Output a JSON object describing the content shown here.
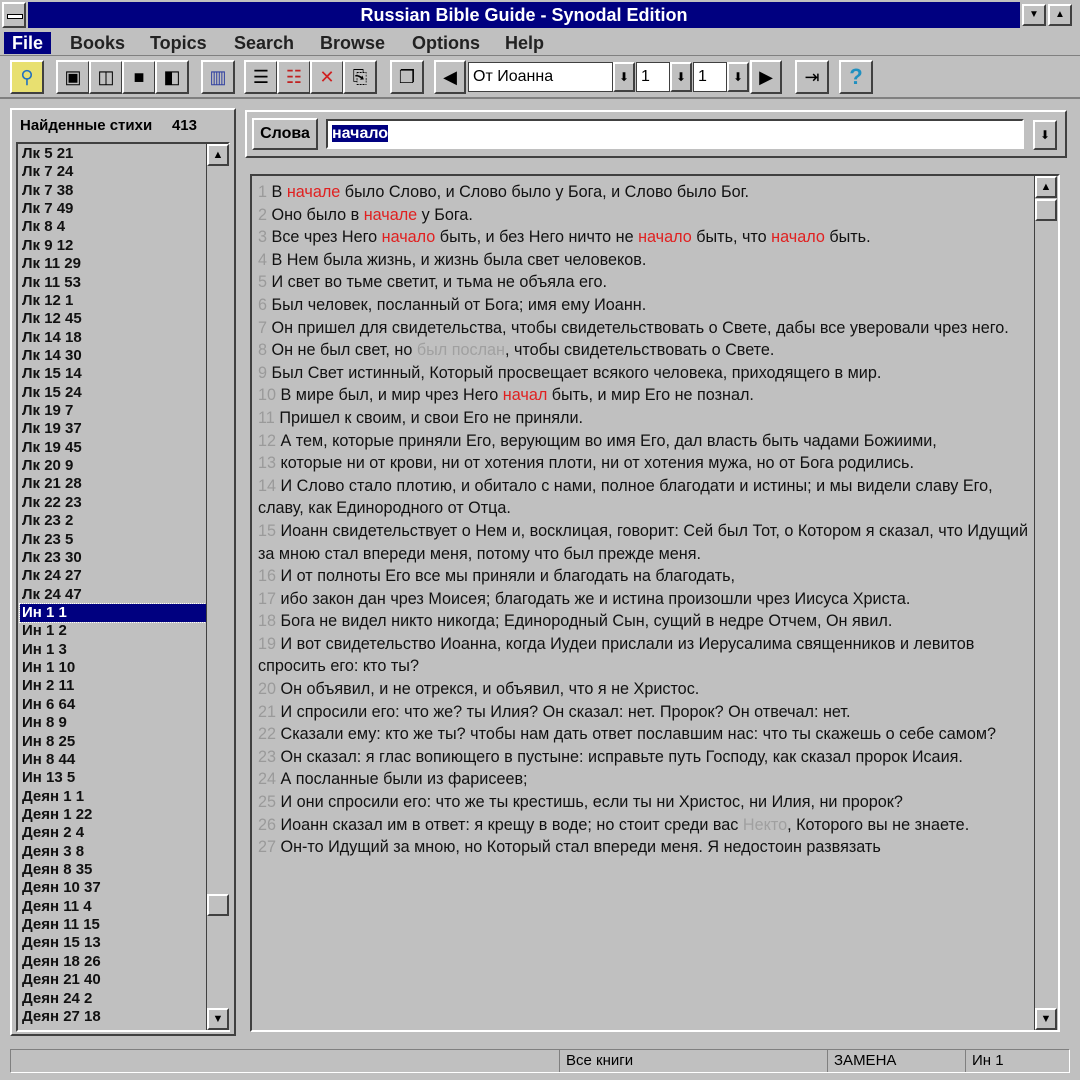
{
  "window": {
    "title": "Russian Bible Guide - Synodal Edition",
    "minimize_icon": "▼",
    "maximize_icon": "▲"
  },
  "menu": [
    {
      "label": "File",
      "active": true
    },
    {
      "label": "Books"
    },
    {
      "label": "Topics"
    },
    {
      "label": "Search"
    },
    {
      "label": "Browse"
    },
    {
      "label": "Options"
    },
    {
      "label": "Help"
    }
  ],
  "toolbar": {
    "book": "От Иоанна",
    "chapter": "1",
    "verse": "1",
    "dropdown_glyph": "⬇",
    "help_glyph": "?"
  },
  "found": {
    "title": "Найденные стихи",
    "count": "413",
    "selected_index": 25,
    "items": [
      "Лк 5 21",
      "Лк 7 24",
      "Лк 7 38",
      "Лк 7 49",
      "Лк 8 4",
      "Лк 9 12",
      "Лк 11 29",
      "Лк 11 53",
      "Лк 12 1",
      "Лк 12 45",
      "Лк 14 18",
      "Лк 14 30",
      "Лк 15 14",
      "Лк 15 24",
      "Лк 19 7",
      "Лк 19 37",
      "Лк 19 45",
      "Лк 20 9",
      "Лк 21 28",
      "Лк 22 23",
      "Лк 23 2",
      "Лк 23 5",
      "Лк 23 30",
      "Лк 24 27",
      "Лк 24 47",
      "Ин 1 1",
      "Ин 1 2",
      "Ин 1 3",
      "Ин 1 10",
      "Ин 2 11",
      "Ин 6 64",
      "Ин 8 9",
      "Ин 8 25",
      "Ин 8 44",
      "Ин 13 5",
      "Деян 1 1",
      "Деян 1 22",
      "Деян 2 4",
      "Деян 3 8",
      "Деян 8 35",
      "Деян 10 37",
      "Деян 11 4",
      "Деян 11 15",
      "Деян 15 13",
      "Деян 18 26",
      "Деян 21 40",
      "Деян 24 2",
      "Деян 27 18"
    ]
  },
  "search": {
    "button": "Слова",
    "value": "начало"
  },
  "colors": {
    "highlight": "#e02020",
    "dim": "#a0a0a0",
    "selection": "#000080"
  },
  "verses": [
    {
      "n": "1",
      "parts": [
        [
          "В ",
          ""
        ],
        [
          "начале",
          "hl"
        ],
        [
          " было Слово, и Слово было у Бога, и Слово было Бог.",
          ""
        ]
      ]
    },
    {
      "n": "2",
      "parts": [
        [
          "Оно было в ",
          ""
        ],
        [
          "начале",
          "hl"
        ],
        [
          " у Бога.",
          ""
        ]
      ]
    },
    {
      "n": "3",
      "parts": [
        [
          "Все чрез Него ",
          ""
        ],
        [
          "начало",
          "hl"
        ],
        [
          " быть, и без Него ничто не ",
          ""
        ],
        [
          "начало",
          "hl"
        ],
        [
          " быть, что ",
          ""
        ],
        [
          "начало",
          "hl"
        ],
        [
          " быть.",
          ""
        ]
      ]
    },
    {
      "n": "4",
      "parts": [
        [
          "В Нем была жизнь, и жизнь была свет человеков.",
          ""
        ]
      ]
    },
    {
      "n": "5",
      "parts": [
        [
          "И свет во тьме светит, и тьма не объяла его.",
          ""
        ]
      ]
    },
    {
      "n": "6",
      "parts": [
        [
          "Был человек, посланный от Бога; имя ему Иоанн.",
          ""
        ]
      ]
    },
    {
      "n": "7",
      "parts": [
        [
          "Он пришел для свидетельства, чтобы свидетельствовать о Свете, дабы все уверовали чрез него.",
          ""
        ]
      ]
    },
    {
      "n": "8",
      "parts": [
        [
          "Он не был свет, но ",
          ""
        ],
        [
          "был послан",
          "gr"
        ],
        [
          ", чтобы свидетельствовать о Свете.",
          ""
        ]
      ]
    },
    {
      "n": "9",
      "parts": [
        [
          "Был Свет истинный, Который просвещает всякого человека, приходящего в мир.",
          ""
        ]
      ]
    },
    {
      "n": "10",
      "parts": [
        [
          "В мире был, и мир чрез Него ",
          ""
        ],
        [
          "начал",
          "hl"
        ],
        [
          " быть, и мир Его не познал.",
          ""
        ]
      ]
    },
    {
      "n": "11",
      "parts": [
        [
          "Пришел к своим, и свои Его не приняли.",
          ""
        ]
      ]
    },
    {
      "n": "12",
      "parts": [
        [
          "А тем, которые приняли Его, верующим во имя Его, дал власть быть чадами Божиими,",
          ""
        ]
      ]
    },
    {
      "n": "13",
      "parts": [
        [
          "которые ни от крови, ни от хотения плоти, ни от хотения мужа, но от Бога родились.",
          ""
        ]
      ]
    },
    {
      "n": "14",
      "parts": [
        [
          "И Слово стало плотию, и обитало с нами, полное благодати и истины; и мы видели славу Его, славу, как Единородного от Отца.",
          ""
        ]
      ]
    },
    {
      "n": "15",
      "parts": [
        [
          "Иоанн свидетельствует о Нем и, восклицая, говорит: Сей был Тот, о Котором я сказал, что Идущий за мною стал впереди меня, потому что был прежде меня.",
          ""
        ]
      ]
    },
    {
      "n": "16",
      "parts": [
        [
          "И от полноты Его все мы приняли и благодать на благодать,",
          ""
        ]
      ]
    },
    {
      "n": "17",
      "parts": [
        [
          "ибо закон дан чрез Моисея; благодать же и истина произошли чрез Иисуса Христа.",
          ""
        ]
      ]
    },
    {
      "n": "18",
      "parts": [
        [
          "Бога не видел никто никогда; Единородный Сын, сущий в недре Отчем, Он явил.",
          ""
        ]
      ]
    },
    {
      "n": "19",
      "parts": [
        [
          "И вот свидетельство Иоанна, когда Иудеи прислали из Иерусалима священников и левитов спросить его: кто ты?",
          ""
        ]
      ]
    },
    {
      "n": "20",
      "parts": [
        [
          "Он объявил, и не отрекся, и объявил, что я не Христос.",
          ""
        ]
      ]
    },
    {
      "n": "21",
      "parts": [
        [
          "И спросили его: что же? ты Илия? Он сказал: нет. Пророк? Он отвечал: нет.",
          ""
        ]
      ]
    },
    {
      "n": "22",
      "parts": [
        [
          "Сказали ему: кто же ты? чтобы нам дать ответ пославшим нас: что ты скажешь о себе самом?",
          ""
        ]
      ]
    },
    {
      "n": "23",
      "parts": [
        [
          "Он сказал: я глас вопиющего в пустыне: исправьте путь Господу, как сказал пророк Исаия.",
          ""
        ]
      ]
    },
    {
      "n": "24",
      "parts": [
        [
          "А посланные были из фарисеев;",
          ""
        ]
      ]
    },
    {
      "n": "25",
      "parts": [
        [
          "И они спросили его: что же ты крестишь, если ты ни Христос, ни Илия, ни пророк?",
          ""
        ]
      ]
    },
    {
      "n": "26",
      "parts": [
        [
          "Иоанн сказал им в ответ: я крещу в воде; но стоит среди вас ",
          ""
        ],
        [
          "Некто",
          "gr"
        ],
        [
          ", Которого вы не знаете.",
          ""
        ]
      ]
    },
    {
      "n": "27",
      "parts": [
        [
          "Он-то Идущий за мною, но Который стал впереди меня. Я недостоин развязать",
          ""
        ]
      ]
    }
  ],
  "status": {
    "scope": "Все книги",
    "mode": "ЗАМЕНА",
    "ref": "Ин 1"
  }
}
